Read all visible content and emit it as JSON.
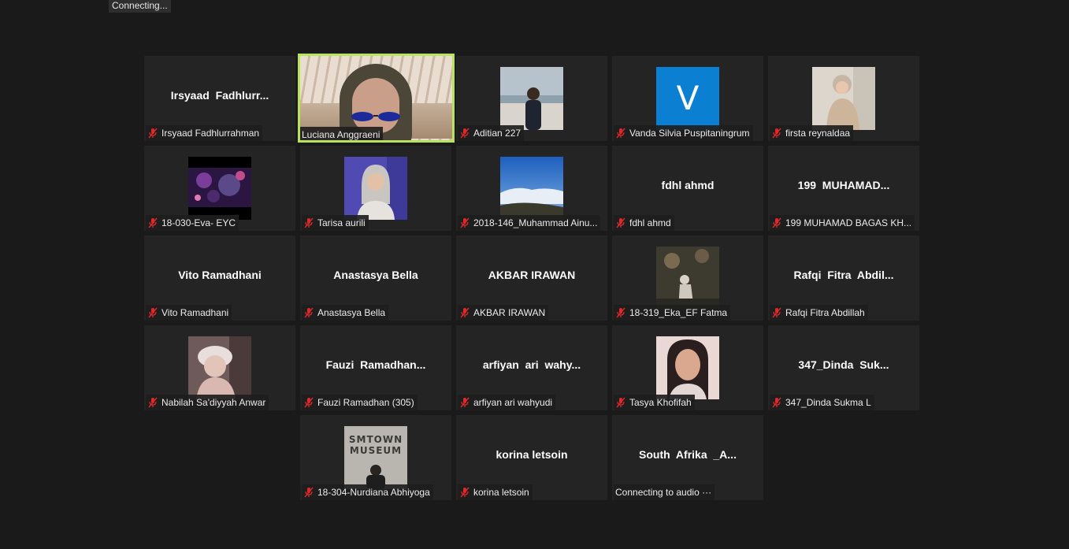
{
  "status_text": "Connecting...",
  "colors": {
    "background": "#1a1a1a",
    "tile": "#242424",
    "active_border": "#b9e35b",
    "mic_muted": "#e02828"
  },
  "participants": [
    {
      "label": "Irsyaad Fadhlurrahman",
      "display": "Irsyaad  Fadhlurr...",
      "muted": true
    },
    {
      "label": "Luciana Anggraeni",
      "display": "",
      "muted": false,
      "active_speaker": true
    },
    {
      "label": "Aditian 227",
      "display": "",
      "muted": true
    },
    {
      "label": "Vanda Silvia Puspitaningrum",
      "display": "",
      "avatar_letter": "V",
      "muted": true
    },
    {
      "label": "firsta reynaldaa",
      "display": "",
      "muted": true
    },
    {
      "label": "18-030-Eva- EYC",
      "display": "",
      "muted": true
    },
    {
      "label": "Tarisa aurili",
      "display": "",
      "muted": true
    },
    {
      "label": "2018-146_Muhammad Ainu...",
      "display": "",
      "muted": true
    },
    {
      "label": "fdhl ahmd",
      "display": "fdhl ahmd",
      "muted": true
    },
    {
      "label": "199 MUHAMAD BAGAS KH...",
      "display": "199  MUHAMAD...",
      "muted": true
    },
    {
      "label": "Vito Ramadhani",
      "display": "Vito Ramadhani",
      "muted": true
    },
    {
      "label": "Anastasya Bella",
      "display": "Anastasya Bella",
      "muted": true
    },
    {
      "label": "AKBAR IRAWAN",
      "display": "AKBAR IRAWAN",
      "muted": true
    },
    {
      "label": "18-319_Eka_EF Fatma",
      "display": "",
      "muted": true
    },
    {
      "label": "Rafqi Fitra Abdillah",
      "display": "Rafqi  Fitra  Abdil...",
      "muted": true
    },
    {
      "label": "Nabilah Sa'diyyah Anwar",
      "display": "",
      "muted": true
    },
    {
      "label": "Fauzi Ramadhan (305)",
      "display": "Fauzi  Ramadhan...",
      "muted": true
    },
    {
      "label": "arfiyan ari wahyudi",
      "display": "arfiyan  ari  wahy...",
      "muted": true
    },
    {
      "label": "Tasya Khofifah",
      "display": "",
      "muted": true
    },
    {
      "label": "347_Dinda Sukma L",
      "display": "347_Dinda  Suk...",
      "muted": true
    },
    {
      "label": "18-304-Nurdiana Abhiyoga",
      "display": "",
      "thumb_text": [
        "SMTOWN",
        "MUSEUM"
      ],
      "muted": true
    },
    {
      "label": "korina letsoin",
      "display": "korina letsoin",
      "muted": true
    },
    {
      "label": "Connecting to audio ···",
      "display": "South  Afrika  _A...",
      "muted": false
    }
  ]
}
